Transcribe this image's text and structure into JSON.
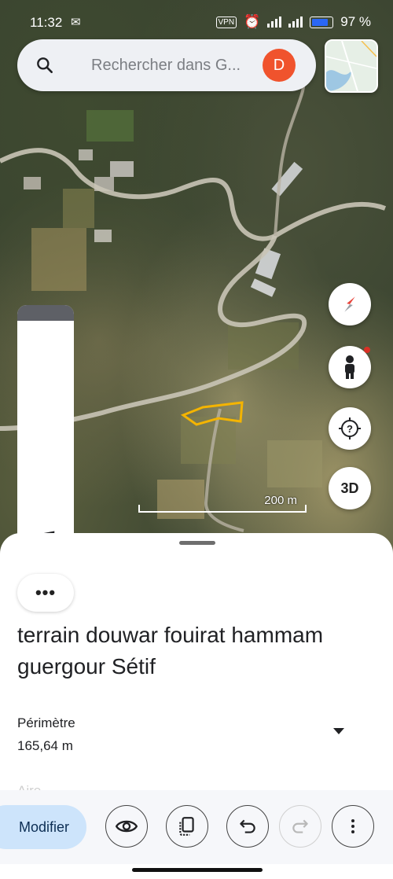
{
  "status_bar": {
    "time": "11:32",
    "vpn_label": "VPN",
    "battery": "97 %"
  },
  "search": {
    "placeholder": "Rechercher dans G...",
    "avatar_letter": "D"
  },
  "map": {
    "scale_label": "200 m",
    "three_d_label": "3D"
  },
  "place": {
    "title": "terrain douwar fouirat hammam guergour Sétif",
    "perimeter_label": "Périmètre",
    "perimeter_value": "165,64 m",
    "next_label_partial": "Aire"
  },
  "toolbar": {
    "modify_label": "Modifier"
  },
  "icons": {
    "search": "search-icon",
    "compass": "compass-icon",
    "street_view": "pegman-icon",
    "help": "help-circle-icon",
    "music": "music-note-icon",
    "more": "more-horizontal-icon",
    "eye": "eye-icon",
    "copy": "copy-icon",
    "undo": "undo-icon",
    "redo": "redo-icon",
    "more_vert": "more-vertical-icon"
  },
  "colors": {
    "avatar": "#f0532d",
    "accent_button": "#cde4fb",
    "polygon": "#f4b400",
    "battery": "#2a67f5"
  }
}
